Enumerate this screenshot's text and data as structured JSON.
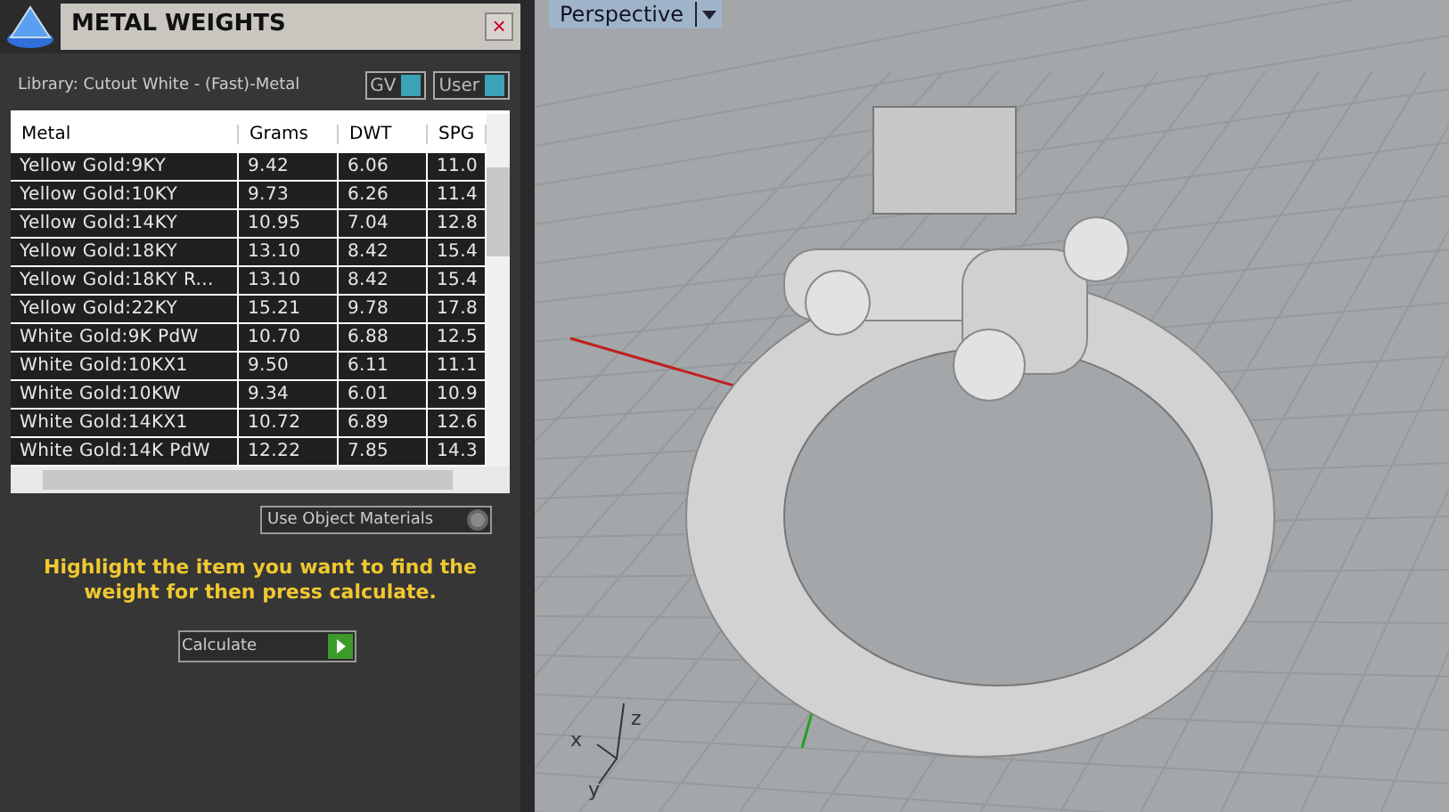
{
  "panel": {
    "title": "METAL WEIGHTS",
    "close": "×",
    "library": "Library: Cutout White - (Fast)-Metal",
    "toggles": [
      {
        "label": "GV",
        "on": true
      },
      {
        "label": "User",
        "on": true
      }
    ],
    "table": {
      "columns": [
        "Metal",
        "Grams",
        "DWT",
        "SPG"
      ],
      "rows": [
        {
          "cells": [
            "Yellow Gold:9KY",
            "9.42",
            "6.06",
            "11.0"
          ],
          "selected": false
        },
        {
          "cells": [
            "Yellow Gold:10KY",
            "9.73",
            "6.26",
            "11.4"
          ],
          "selected": false
        },
        {
          "cells": [
            "Yellow Gold:14KY",
            "10.95",
            "7.04",
            "12.8"
          ],
          "selected": false
        },
        {
          "cells": [
            "Yellow Gold:18KY",
            "13.10",
            "8.42",
            "15.4"
          ],
          "selected": false
        },
        {
          "cells": [
            "Yellow Gold:18KY R...",
            "13.10",
            "8.42",
            "15.4"
          ],
          "selected": false
        },
        {
          "cells": [
            "Yellow Gold:22KY",
            "15.21",
            "9.78",
            "17.8"
          ],
          "selected": false
        },
        {
          "cells": [
            "White Gold:9K PdW",
            "10.70",
            "6.88",
            "12.5"
          ],
          "selected": false
        },
        {
          "cells": [
            "White Gold:10KX1",
            "9.50",
            "6.11",
            "11.1"
          ],
          "selected": false
        },
        {
          "cells": [
            "White Gold:10KW",
            "9.34",
            "6.01",
            "10.9"
          ],
          "selected": false
        },
        {
          "cells": [
            "White Gold:14KX1",
            "10.72",
            "6.89",
            "12.6"
          ],
          "selected": false
        },
        {
          "cells": [
            "White Gold:14K PdW",
            "12.22",
            "7.85",
            "14.3"
          ],
          "selected": false
        }
      ]
    },
    "use_object_materials": {
      "label": "Use Object Materials",
      "checked": false
    },
    "message": "Highlight the item you want to find the weight for then press calculate.",
    "calculate": "Calculate"
  },
  "viewport": {
    "tab": "Perspective",
    "axes": [
      "x",
      "y",
      "z"
    ]
  }
}
